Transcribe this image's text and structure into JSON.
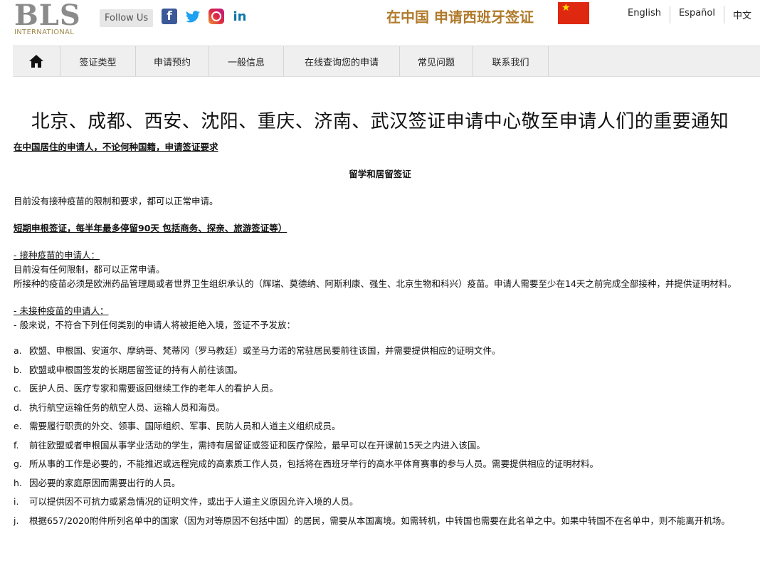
{
  "header": {
    "logo": {
      "brand": "BLS",
      "sub": "INTERNATIONAL"
    },
    "follow_us": "Follow Us",
    "social": {
      "facebook": "f",
      "twitter": "🐦",
      "linkedin": "in"
    },
    "site_title": "在中国 申请西班牙签证",
    "flag_icon": "china-flag-icon",
    "languages": [
      "English",
      "Español",
      "中文"
    ]
  },
  "nav": {
    "home_icon": "home-icon",
    "items": [
      "签证类型",
      "申请预约",
      "一般信息",
      "在线查询您的申请",
      "常见问题",
      "联系我们"
    ]
  },
  "content": {
    "heading": "北京、成都、西安、沈阳、重庆、济南、武汉签证申请中心敬至申请人们的重要通知",
    "sub_heading": "在中国居住的申请人，不论何种国籍，申请签证要求",
    "section_title": "留学和居留签证",
    "para1": "目前没有接种疫苗的限制和要求，都可以正常申请。",
    "short_stay_title": "短期申根签证，每半年最多停留90天 包括商务、探亲、旅游签证等）",
    "vaccinated_title": "- 接种疫苗的申请人：",
    "vaccinated_p1": "目前没有任何限制，都可以正常申请。",
    "vaccinated_p2": "所接种的疫苗必须是欧洲药品管理局或者世界卫生组织承认的（辉瑞、莫德纳、阿斯利康、强生、北京生物和科兴）疫苗。申请人需要至少在14天之前完成全部接种，并提供证明材料。",
    "unvaccinated_title": "- 未接种疫苗的申请人：",
    "unvaccinated_p1": "- 般来说，不符合下列任何类别的申请人将被拒绝入境，签证不予发放：",
    "list": [
      {
        "marker": "a.",
        "text": "欧盟、申根国、安道尔、摩纳哥、梵蒂冈（罗马教廷）或圣马力诺的常驻居民要前往该国，并需要提供相应的证明文件。"
      },
      {
        "marker": "b.",
        "text": "欧盟或申根国签发的长期居留签证的持有人前往该国。"
      },
      {
        "marker": "c.",
        "text": "医护人员、医疗专家和需要返回继续工作的老年人的看护人员。"
      },
      {
        "marker": "d.",
        "text": "执行航空运输任务的航空人员、运输人员和海员。"
      },
      {
        "marker": "e.",
        "text": "需要履行职责的外交、领事、国际组织、军事、民防人员和人道主义组织成员。"
      },
      {
        "marker": "f.",
        "text": "前往欧盟或者申根国从事学业活动的学生，需持有居留证或签证和医疗保险，最早可以在开课前15天之内进入该国。"
      },
      {
        "marker": "g.",
        "text": "所从事的工作是必要的，不能推迟或远程完成的高素质工作人员，包括将在西班牙举行的高水平体育赛事的参与人员。需要提供相应的证明材料。"
      },
      {
        "marker": "h.",
        "text": "因必要的家庭原因而需要出行的人员。"
      },
      {
        "marker": "i.",
        "text": "可以提供因不可抗力或紧急情况的证明文件，或出于人道主义原因允许入境的人员。"
      },
      {
        "marker": "j.",
        "text": "根据657/2020附件所列名单中的国家（因为对等原因不包括中国）的居民，需要从本国离境。如需转机，中转国也需要在此名单之中。如果中转国不在名单中，则不能离开机场。"
      }
    ]
  }
}
